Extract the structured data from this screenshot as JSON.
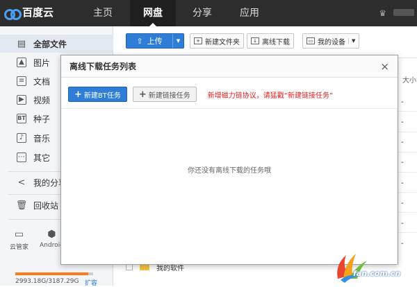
{
  "app": {
    "logo_text": "百度云"
  },
  "nav": {
    "items": [
      "主页",
      "网盘",
      "分享",
      "应用"
    ],
    "active": "网盘"
  },
  "sidebar": {
    "items": [
      {
        "label": "全部文件",
        "icon": "files-icon"
      },
      {
        "label": "图片",
        "icon": "image-icon"
      },
      {
        "label": "文档",
        "icon": "document-icon"
      },
      {
        "label": "视频",
        "icon": "video-icon"
      },
      {
        "label": "种子",
        "icon": "bt-icon",
        "glyph": "BT"
      },
      {
        "label": "音乐",
        "icon": "music-icon"
      },
      {
        "label": "其它",
        "icon": "other-icon"
      },
      {
        "label": "我的分享",
        "icon": "share-icon"
      },
      {
        "label": "回收站",
        "icon": "trash-icon"
      }
    ],
    "devices": [
      {
        "label": "云管家",
        "icon": "monitor-icon"
      },
      {
        "label": "Android",
        "icon": "android-icon"
      }
    ],
    "quota": {
      "text": "2993.18G/3187.29G",
      "used_fraction": 0.94,
      "expand_label": "扩容"
    }
  },
  "toolbar": {
    "upload_label": "上传",
    "new_folder_label": "新建文件夹",
    "offline_download_label": "离线下载",
    "my_device_label": "我的设备"
  },
  "content": {
    "size_col_label": "大小",
    "row_value": "-",
    "visible_folder": "我的软件"
  },
  "modal": {
    "title": "离线下载任务列表",
    "close_symbol": "×",
    "new_bt_label": "新建BT任务",
    "new_link_label": "新建链接任务",
    "hint": "新增磁力链协议，请猛戳“新建链接任务”",
    "empty_text": "你还没有离线下载的任务哦"
  },
  "watermark": {
    "text": "fan.com.cn"
  },
  "colors": {
    "accent": "#2e7ed8",
    "topbar": "#2d2d2d",
    "hint": "#e02020",
    "quota": "#ff7a1b"
  }
}
